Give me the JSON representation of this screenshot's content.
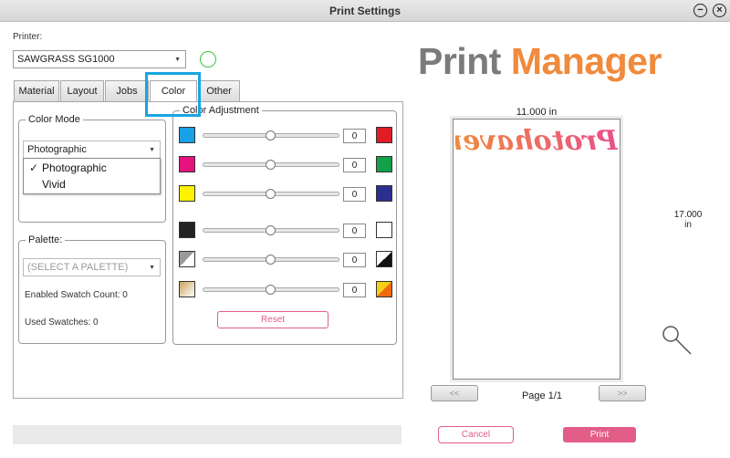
{
  "window": {
    "title": "Print Settings"
  },
  "printer": {
    "label": "Printer:",
    "selected": "SAWGRASS SG1000"
  },
  "tabs": [
    {
      "label": "Material"
    },
    {
      "label": "Layout"
    },
    {
      "label": "Jobs"
    },
    {
      "label": "Color"
    },
    {
      "label": "Other"
    }
  ],
  "color_mode": {
    "title": "Color Mode",
    "selected": "Photographic",
    "options": [
      "Photographic",
      "Vivid"
    ],
    "check_mark": "✓"
  },
  "palette": {
    "title": "Palette:",
    "placeholder": "(SELECT A PALETTE)",
    "enabled_swatch_count": "Enabled Swatch Count:  0",
    "used_swatches": "Used Swatches: 0"
  },
  "color_adjustment": {
    "title": "Color Adjustment",
    "rows": [
      {
        "left": "cyan",
        "right": "red",
        "value": "0",
        "level": 0.5
      },
      {
        "left": "magenta",
        "right": "green",
        "value": "0",
        "level": 0.5
      },
      {
        "left": "yellow",
        "right": "blue",
        "value": "0",
        "level": 0.5
      },
      {
        "left": "black",
        "right": "white",
        "value": "0",
        "level": 0.5
      },
      {
        "left": "gray-white",
        "right": "white-black",
        "value": "0",
        "level": 0.5
      },
      {
        "left": "tan-gradient",
        "right": "yellow-orange",
        "value": "0",
        "level": 0.5
      }
    ],
    "reset_label": "Reset"
  },
  "logo": {
    "word1": "Print",
    "word2": "Manager",
    "colors": {
      "word1": "#7b7b7b",
      "word2": "#f08a3c"
    }
  },
  "preview": {
    "width_label": "11.000 in",
    "height_value": "17.000",
    "height_unit": "in",
    "artwork_text": "Protohaven",
    "page_label": "Page 1/1",
    "prev_label": "<<",
    "next_label": ">>"
  },
  "actions": {
    "cancel_label": "Cancel",
    "print_label": "Print"
  },
  "colors": {
    "accent_pink": "#e25d87",
    "tab_highlight": "#1aa5e0",
    "status_ok": "#39c439"
  }
}
